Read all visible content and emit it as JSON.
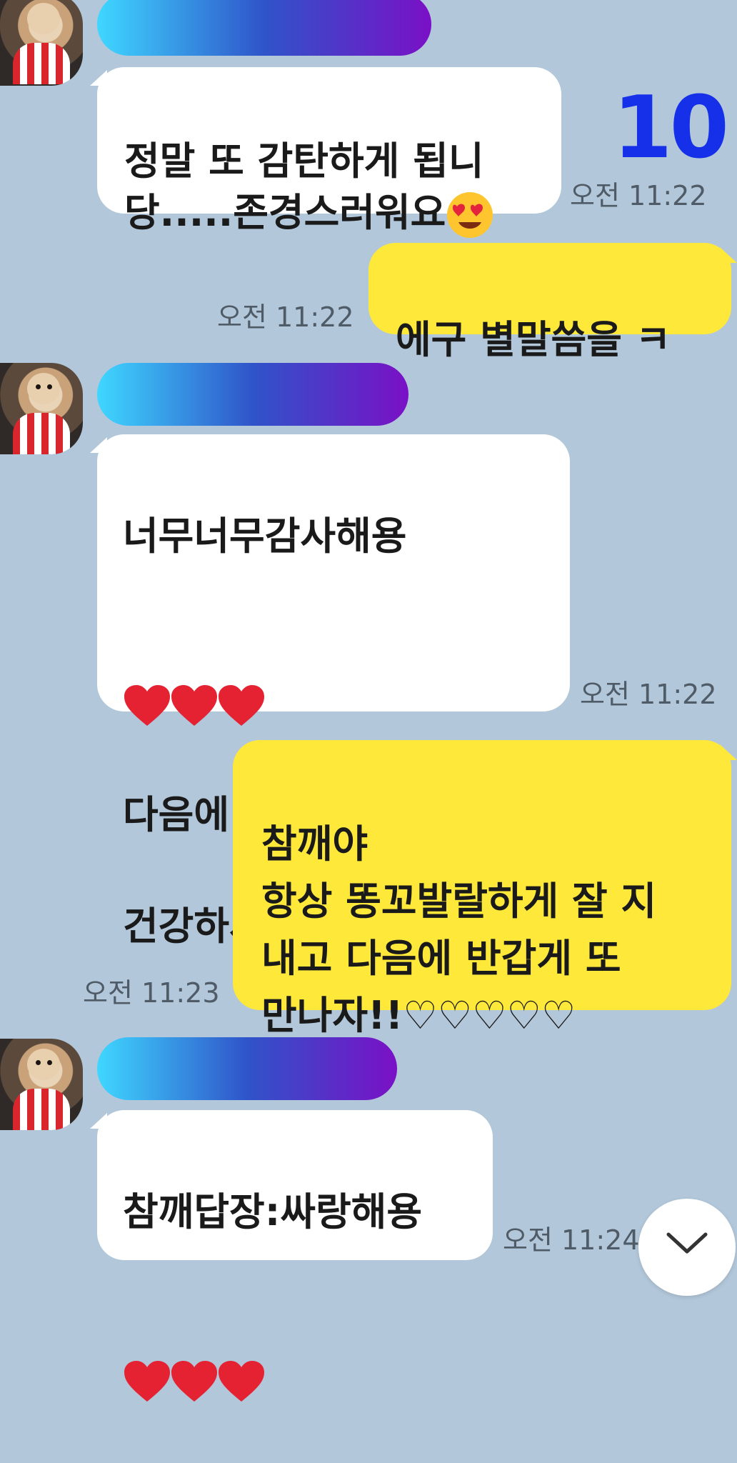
{
  "chat": {
    "counter_badge": "10",
    "messages": [
      {
        "side": "in",
        "text": "정말 또 감탄하게 됩니\n당.....존경스러워요",
        "emoji": "heart-eyes-emoji",
        "time": "오전 11:22"
      },
      {
        "side": "out",
        "text": "에구 별말씀을 ㅋ",
        "time": "오전 11:22"
      },
      {
        "side": "in",
        "line1": "너무너무감사해용",
        "line3": "다음에 또올게요",
        "line4": "건강하세요",
        "emoji": "kakao-character-emoji",
        "time": "오전 11:22"
      },
      {
        "side": "out",
        "text": "참깨야\n항상 똥꼬발랄하게 잘 지\n내고 다음에 반갑게 또\n만나자!!♡♡♡♡♡",
        "time": "오전 11:23"
      },
      {
        "side": "in",
        "text": "참깨답장:싸랑해용",
        "time": "오전 11:24"
      }
    ],
    "scroll_down_icon": "chevron-down-icon"
  },
  "colors": {
    "background": "#b2c7da",
    "incoming_bubble": "#ffffff",
    "outgoing_bubble": "#fee83a",
    "counter": "#1530e8"
  }
}
